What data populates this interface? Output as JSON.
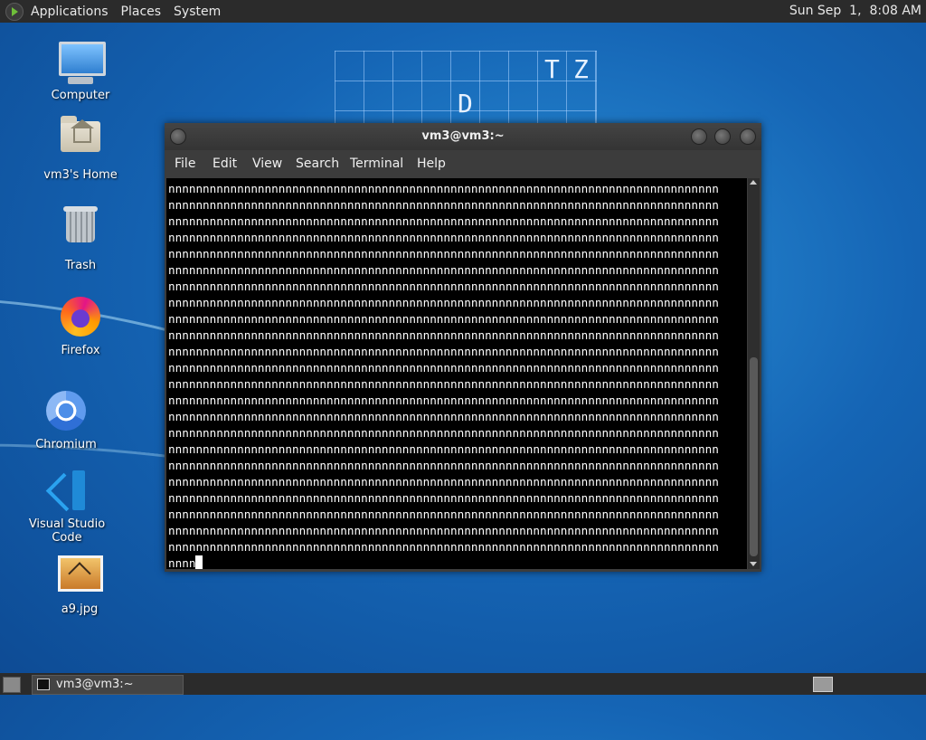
{
  "top_panel": {
    "menus": [
      "Applications",
      "Places",
      "System"
    ],
    "clock": "Sun Sep  1,  8:08 AM"
  },
  "wallpaper": {
    "letters": [
      "T",
      "Z",
      "D"
    ]
  },
  "desktop_icons": [
    {
      "label": "Computer"
    },
    {
      "label": "vm3's Home"
    },
    {
      "label": "Trash"
    },
    {
      "label": "Firefox"
    },
    {
      "label": "Chromium"
    },
    {
      "label": "Visual Studio Code"
    },
    {
      "label": "a9.jpg"
    }
  ],
  "terminal": {
    "title": "vm3@vm3:~",
    "menu": [
      "File",
      "Edit",
      "View",
      "Search",
      "Terminal",
      "Help"
    ],
    "lines": [
      "nnnnnnnnnnnnnnnnnnnnnnnnnnnnnnnnnnnnnnnnnnnnnnnnnnnnnnnnnnnnnnnnnnnnnnnnnnnnnnnn",
      "nnnnnnnnnnnnnnnnnnnnnnnnnnnnnnnnnnnnnnnnnnnnnnnnnnnnnnnnnnnnnnnnnnnnnnnnnnnnnnnn",
      "nnnnnnnnnnnnnnnnnnnnnnnnnnnnnnnnnnnnnnnnnnnnnnnnnnnnnnnnnnnnnnnnnnnnnnnnnnnnnnnn",
      "nnnnnnnnnnnnnnnnnnnnnnnnnnnnnnnnnnnnnnnnnnnnnnnnnnnnnnnnnnnnnnnnnnnnnnnnnnnnnnnn",
      "nnnnnnnnnnnnnnnnnnnnnnnnnnnnnnnnnnnnnnnnnnnnnnnnnnnnnnnnnnnnnnnnnnnnnnnnnnnnnnnn",
      "nnnnnnnnnnnnnnnnnnnnnnnnnnnnnnnnnnnnnnnnnnnnnnnnnnnnnnnnnnnnnnnnnnnnnnnnnnnnnnnn",
      "nnnnnnnnnnnnnnnnnnnnnnnnnnnnnnnnnnnnnnnnnnnnnnnnnnnnnnnnnnnnnnnnnnnnnnnnnnnnnnnn",
      "nnnnnnnnnnnnnnnnnnnnnnnnnnnnnnnnnnnnnnnnnnnnnnnnnnnnnnnnnnnnnnnnnnnnnnnnnnnnnnnn",
      "nnnnnnnnnnnnnnnnnnnnnnnnnnnnnnnnnnnnnnnnnnnnnnnnnnnnnnnnnnnnnnnnnnnnnnnnnnnnnnnn",
      "nnnnnnnnnnnnnnnnnnnnnnnnnnnnnnnnnnnnnnnnnnnnnnnnnnnnnnnnnnnnnnnnnnnnnnnnnnnnnnnn",
      "nnnnnnnnnnnnnnnnnnnnnnnnnnnnnnnnnnnnnnnnnnnnnnnnnnnnnnnnnnnnnnnnnnnnnnnnnnnnnnnn",
      "nnnnnnnnnnnnnnnnnnnnnnnnnnnnnnnnnnnnnnnnnnnnnnnnnnnnnnnnnnnnnnnnnnnnnnnnnnnnnnnn",
      "nnnnnnnnnnnnnnnnnnnnnnnnnnnnnnnnnnnnnnnnnnnnnnnnnnnnnnnnnnnnnnnnnnnnnnnnnnnnnnnn",
      "nnnnnnnnnnnnnnnnnnnnnnnnnnnnnnnnnnnnnnnnnnnnnnnnnnnnnnnnnnnnnnnnnnnnnnnnnnnnnnnn",
      "nnnnnnnnnnnnnnnnnnnnnnnnnnnnnnnnnnnnnnnnnnnnnnnnnnnnnnnnnnnnnnnnnnnnnnnnnnnnnnnn",
      "nnnnnnnnnnnnnnnnnnnnnnnnnnnnnnnnnnnnnnnnnnnnnnnnnnnnnnnnnnnnnnnnnnnnnnnnnnnnnnnn",
      "nnnnnnnnnnnnnnnnnnnnnnnnnnnnnnnnnnnnnnnnnnnnnnnnnnnnnnnnnnnnnnnnnnnnnnnnnnnnnnnn",
      "nnnnnnnnnnnnnnnnnnnnnnnnnnnnnnnnnnnnnnnnnnnnnnnnnnnnnnnnnnnnnnnnnnnnnnnnnnnnnnnn",
      "nnnnnnnnnnnnnnnnnnnnnnnnnnnnnnnnnnnnnnnnnnnnnnnnnnnnnnnnnnnnnnnnnnnnnnnnnnnnnnnn",
      "nnnnnnnnnnnnnnnnnnnnnnnnnnnnnnnnnnnnnnnnnnnnnnnnnnnnnnnnnnnnnnnnnnnnnnnnnnnnnnnn",
      "nnnnnnnnnnnnnnnnnnnnnnnnnnnnnnnnnnnnnnnnnnnnnnnnnnnnnnnnnnnnnnnnnnnnnnnnnnnnnnnn",
      "nnnnnnnnnnnnnnnnnnnnnnnnnnnnnnnnnnnnnnnnnnnnnnnnnnnnnnnnnnnnnnnnnnnnnnnnnnnnnnnn",
      "nnnnnnnnnnnnnnnnnnnnnnnnnnnnnnnnnnnnnnnnnnnnnnnnnnnnnnnnnnnnnnnnnnnnnnnnnnnnnnnn"
    ],
    "prompt_line": "nnnn"
  },
  "bottom_panel": {
    "task_label": "vm3@vm3:~"
  },
  "icons": {
    "applications": "gnome-foot-icon",
    "computer": "monitor-icon",
    "home": "home-folder-icon",
    "trash": "trash-icon",
    "firefox": "firefox-icon",
    "chromium": "chromium-icon",
    "vscode": "vscode-icon",
    "image": "image-file-icon"
  },
  "colors": {
    "panel": "#2b2b2b",
    "terminal_bg": "#000000",
    "terminal_fg": "#ffffff",
    "desktop": "#1565b5"
  }
}
